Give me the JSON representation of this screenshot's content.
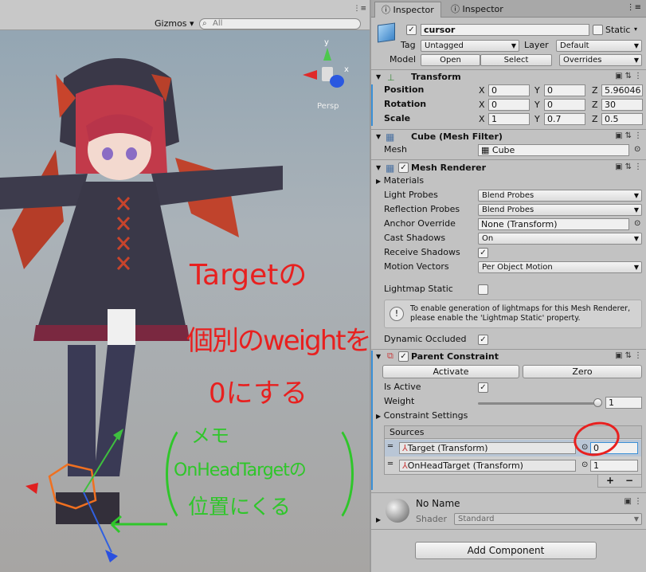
{
  "scene": {
    "gizmos_label": "Gizmos",
    "search_placeholder": "All",
    "persp_label": "Persp",
    "axis_y": "y",
    "axis_x": "x",
    "axis_z": "z",
    "menu_icon": "kebab-menu-icon",
    "annotation_red_1": "Targetの",
    "annotation_red_2": "個別のweightを",
    "annotation_red_3": "0にする",
    "annotation_green_1": "メモ",
    "annotation_green_2": "OnHeadTargetの",
    "annotation_green_3": "位置にくる",
    "annotation_red_color": "#e8201f",
    "annotation_green_color": "#2fc62a"
  },
  "inspector": {
    "tab_active": "Inspector",
    "tab_inactive": "Inspector",
    "object_name": "cursor",
    "static_label": "Static",
    "tag_label": "Tag",
    "tag_value": "Untagged",
    "layer_label": "Layer",
    "layer_value": "Default",
    "model_label": "Model",
    "open_label": "Open",
    "select_label": "Select",
    "overrides_label": "Overrides",
    "transform": {
      "title": "Transform",
      "position_label": "Position",
      "rotation_label": "Rotation",
      "scale_label": "Scale",
      "x": "X",
      "y": "Y",
      "z": "Z",
      "position": [
        "0",
        "0",
        "5.96046"
      ],
      "rotation": [
        "0",
        "0",
        "30"
      ],
      "scale": [
        "1",
        "0.7",
        "0.5"
      ]
    },
    "mesh_filter": {
      "title": "Cube (Mesh Filter)",
      "mesh_label": "Mesh",
      "mesh_value": "Cube"
    },
    "mesh_renderer": {
      "title": "Mesh Renderer",
      "materials": "Materials",
      "light_probes_label": "Light Probes",
      "light_probes_value": "Blend Probes",
      "reflection_probes_label": "Reflection Probes",
      "reflection_probes_value": "Blend Probes",
      "anchor_override_label": "Anchor Override",
      "anchor_override_value": "None (Transform)",
      "cast_shadows_label": "Cast Shadows",
      "cast_shadows_value": "On",
      "receive_shadows_label": "Receive Shadows",
      "motion_vectors_label": "Motion Vectors",
      "motion_vectors_value": "Per Object Motion",
      "lightmap_static_label": "Lightmap Static",
      "info_text_1": "To enable generation of lightmaps for this Mesh Renderer,",
      "info_text_2": "please enable the 'Lightmap Static' property.",
      "dynamic_occluded_label": "Dynamic Occluded"
    },
    "parent_constraint": {
      "title": "Parent Constraint",
      "activate_label": "Activate",
      "zero_label": "Zero",
      "is_active_label": "Is Active",
      "weight_label": "Weight",
      "weight_value": "1",
      "weight_fraction": 1.0,
      "constraint_settings_label": "Constraint Settings",
      "sources_label": "Sources",
      "sources": [
        {
          "name": "Target (Transform)",
          "weight": "0"
        },
        {
          "name": "OnHeadTarget (Transform)",
          "weight": "1"
        }
      ],
      "add_label": "+",
      "remove_label": "−"
    },
    "material": {
      "name": "No Name",
      "shader_label": "Shader",
      "shader_value": "Standard"
    },
    "add_component_label": "Add Component"
  }
}
